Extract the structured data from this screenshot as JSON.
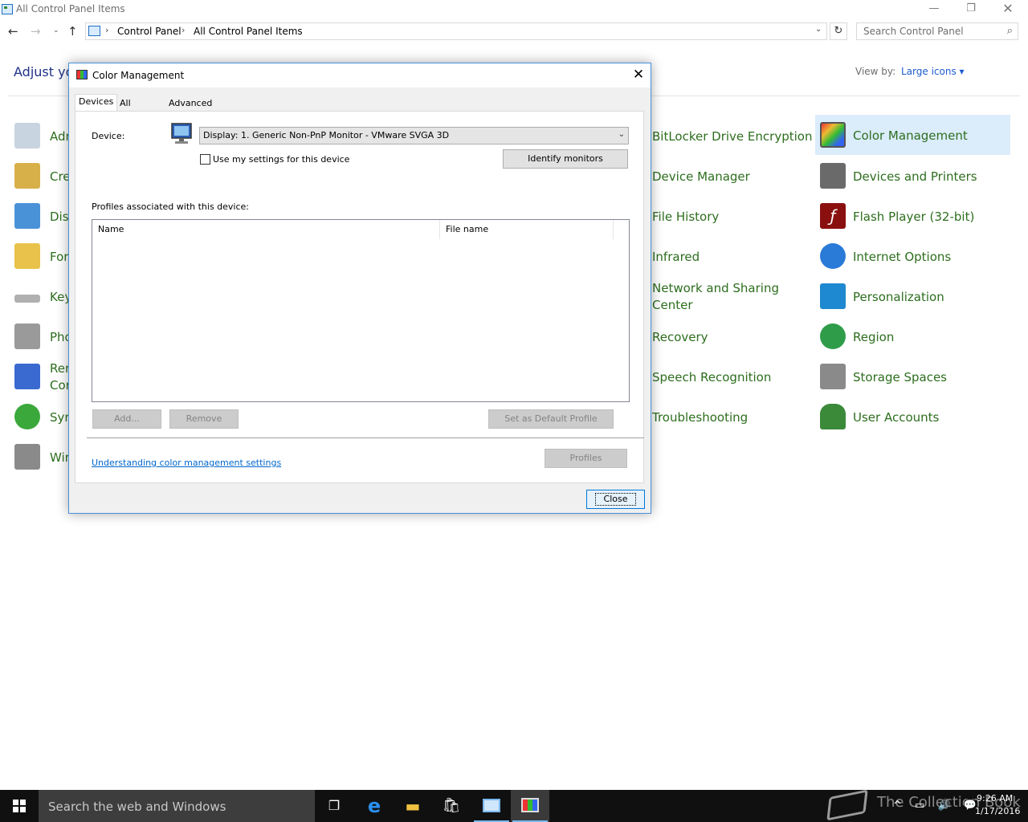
{
  "window": {
    "title": "All Control Panel Items",
    "controls": {
      "minimize": "—",
      "maximize": "❐",
      "close": "✕"
    }
  },
  "nav": {
    "back": "←",
    "forward": "→",
    "recent": "⌄",
    "up": "↑",
    "breadcrumbs": [
      "Control Panel",
      "All Control Panel Items"
    ],
    "separator": "›",
    "dropdown": "⌄",
    "refresh": "↻",
    "search_placeholder": "Search Control Panel",
    "search_icon": "⌕"
  },
  "main": {
    "heading_partial": "Adjust yo",
    "view_by_label": "View by:",
    "view_by_value": "Large icons ▾"
  },
  "items_left_partial": [
    {
      "label": "Adr",
      "icon": "admin-tools-icon"
    },
    {
      "label": "Cre",
      "icon": "credential-manager-icon"
    },
    {
      "label": "Dis",
      "icon": "display-icon"
    },
    {
      "label": "For",
      "icon": "fonts-icon"
    },
    {
      "label": "Key",
      "icon": "keyboard-icon"
    },
    {
      "label": "Pho",
      "icon": "phone-modem-icon"
    },
    {
      "label": "Rer",
      "label2": "Cor",
      "icon": "remoteapp-icon"
    },
    {
      "label": "Syr",
      "icon": "sync-center-icon"
    },
    {
      "label": "Wir",
      "icon": "windows-firewall-icon"
    }
  ],
  "items_col3": [
    {
      "label": "BitLocker Drive Encryption"
    },
    {
      "label": "Device Manager"
    },
    {
      "label": "File History"
    },
    {
      "label": "Infrared"
    },
    {
      "label": "Network and Sharing Center"
    },
    {
      "label": "Recovery"
    },
    {
      "label": "Speech Recognition"
    },
    {
      "label": "Troubleshooting"
    }
  ],
  "items_col4": [
    {
      "label": "Color Management",
      "icon": "color-management-icon",
      "color": "#3a78d8"
    },
    {
      "label": "Devices and Printers",
      "icon": "printer-icon",
      "color": "#6a6a6a"
    },
    {
      "label": "Flash Player (32-bit)",
      "icon": "flash-icon",
      "color": "#8a1010"
    },
    {
      "label": "Internet Options",
      "icon": "internet-options-icon",
      "color": "#2a7ad8"
    },
    {
      "label": "Personalization",
      "icon": "personalization-icon",
      "color": "#1e88d0"
    },
    {
      "label": "Region",
      "icon": "region-globe-icon",
      "color": "#2f9c4a"
    },
    {
      "label": "Storage Spaces",
      "icon": "storage-spaces-icon",
      "color": "#8a8a8a"
    },
    {
      "label": "User Accounts",
      "icon": "user-accounts-icon",
      "color": "#3a8a3a"
    }
  ],
  "dialog": {
    "title": "Color Management",
    "close_glyph": "✕",
    "tabs": [
      "Devices",
      "All Profiles",
      "Advanced"
    ],
    "device_label": "Device:",
    "device_value": "Display: 1. Generic Non-PnP Monitor - VMware SVGA 3D",
    "device_arrow": "⌄",
    "use_my_settings": "Use my settings for this device",
    "identify_button": "Identify monitors",
    "profiles_label": "Profiles associated with this device:",
    "columns": [
      "Name",
      "File name"
    ],
    "add_button": "Add...",
    "remove_button": "Remove",
    "set_default_button": "Set as Default Profile",
    "help_link": "Understanding color management settings",
    "profiles_button": "Profiles",
    "close_button": "Close"
  },
  "taskbar": {
    "search_placeholder": "Search the web and Windows",
    "task_view_glyph": "❐",
    "edge_glyph": "e",
    "explorer_glyph": "▬",
    "store_glyph": "🛍",
    "watermark": "The Collection Book",
    "tray_glyphs": "^ ▭ 🔊 💬",
    "time": "9:26 AM",
    "date": "1/17/2016"
  }
}
